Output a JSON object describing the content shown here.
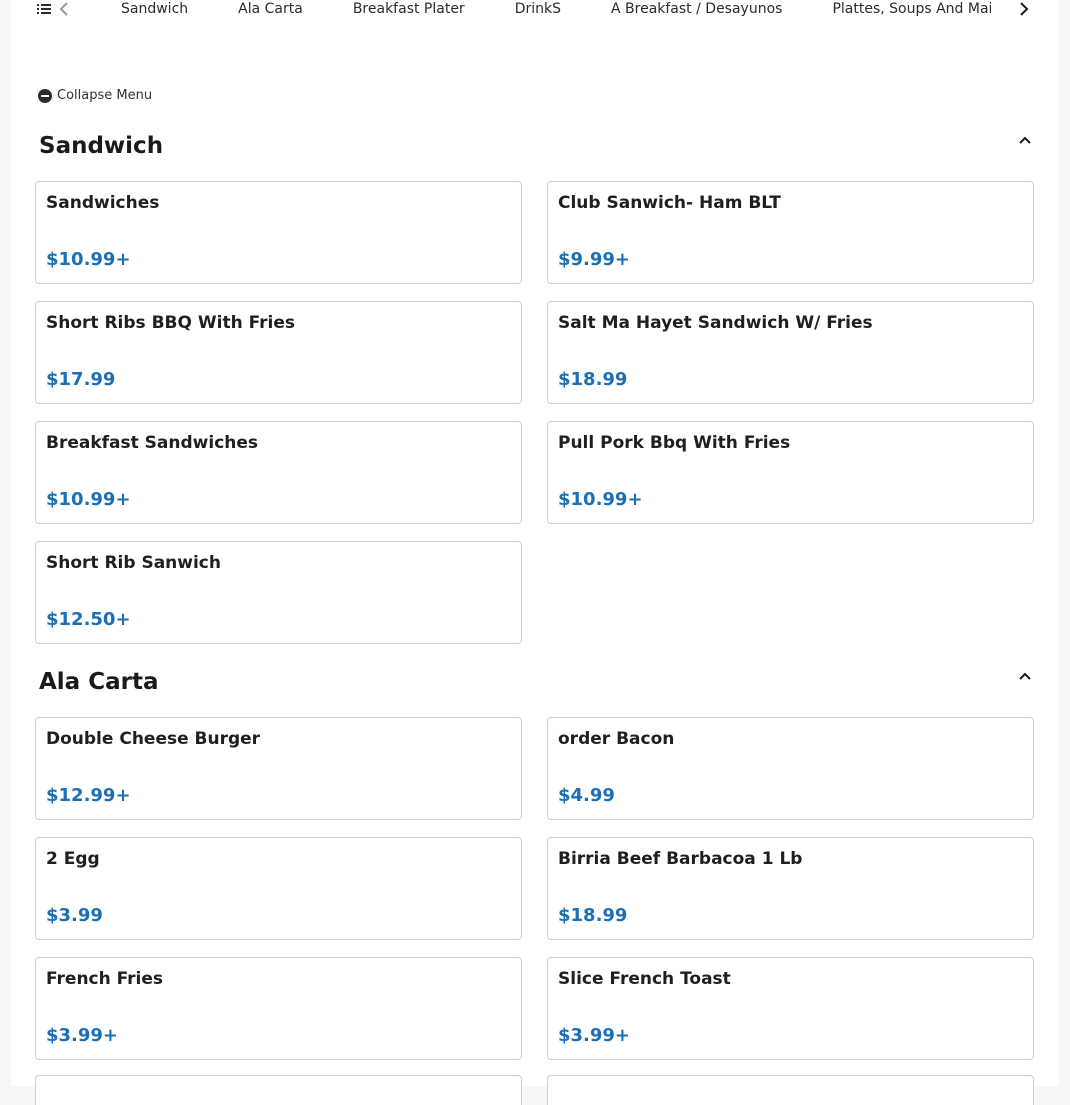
{
  "categories": [
    "Sandwich",
    "Ala Carta",
    "Breakfast Plater",
    "DrinkS",
    "A Breakfast / Desayunos",
    "Plattes, Soups And Mains"
  ],
  "collapse_label": "Collapse Menu",
  "sections": [
    {
      "title": "Sandwich",
      "items": [
        {
          "name": "Sandwiches",
          "price": "$10.99+"
        },
        {
          "name": "Club Sanwich- Ham BLT",
          "price": "$9.99+"
        },
        {
          "name": "Short Ribs BBQ With Fries",
          "price": "$17.99"
        },
        {
          "name": "Salt Ma Hayet Sandwich W/ Fries",
          "price": "$18.99"
        },
        {
          "name": "Breakfast Sandwiches",
          "price": "$10.99+"
        },
        {
          "name": "Pull Pork Bbq With Fries",
          "price": "$10.99+"
        },
        {
          "name": "Short Rib Sanwich",
          "price": "$12.50+"
        }
      ]
    },
    {
      "title": "Ala Carta",
      "items": [
        {
          "name": "Double Cheese Burger",
          "price": "$12.99+"
        },
        {
          "name": "order Bacon",
          "price": "$4.99"
        },
        {
          "name": "2 Egg",
          "price": "$3.99"
        },
        {
          "name": "Birria Beef Barbacoa 1 Lb",
          "price": "$18.99"
        },
        {
          "name": "French Fries",
          "price": "$3.99+"
        },
        {
          "name": "Slice French Toast",
          "price": "$3.99+"
        }
      ]
    }
  ],
  "colors": {
    "price": "#1a6fb5",
    "card_border": "#cfcfcf",
    "page_bg": "#f7f7f7"
  },
  "icons": {
    "menu_list": "list-icon",
    "prev": "chevron-left-icon",
    "next": "chevron-right-icon",
    "collapse": "minus-circle-icon",
    "section_toggle": "chevron-up-icon"
  }
}
